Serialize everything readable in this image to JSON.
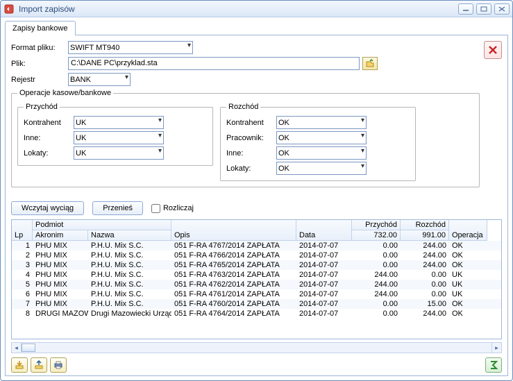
{
  "window": {
    "title": "Import zapisów"
  },
  "tab": {
    "label": "Zapisy bankowe"
  },
  "form": {
    "format_label": "Format pliku:",
    "format_value": "SWIFT MT940",
    "plik_label": "Plik:",
    "plik_value": "C:\\DANE PC\\przyklad.sta",
    "rejestr_label": "Rejestr",
    "rejestr_value": "BANK"
  },
  "ops": {
    "legend": "Operacje kasowe/bankowe",
    "income": {
      "legend": "Przychód",
      "kontrahent_label": "Kontrahent",
      "kontrahent_value": "UK",
      "inne_label": "Inne:",
      "inne_value": "UK",
      "lokaty_label": "Lokaty:",
      "lokaty_value": "UK"
    },
    "expense": {
      "legend": "Rozchód",
      "kontrahent_label": "Kontrahent",
      "kontrahent_value": "OK",
      "pracownik_label": "Pracownik:",
      "pracownik_value": "OK",
      "inne_label": "Inne:",
      "inne_value": "OK",
      "lokaty_label": "Lokaty:",
      "lokaty_value": "OK"
    }
  },
  "actions": {
    "wczytaj": "Wczytaj wyciąg",
    "przenies": "Przenieś",
    "rozliczaj": "Rozliczaj"
  },
  "grid": {
    "headers": {
      "lp": "Lp",
      "podmiot": "Podmiot",
      "akronim": "Akronim",
      "nazwa": "Nazwa",
      "opis": "Opis",
      "data": "Data",
      "przychod": "Przychód",
      "rozchod": "Rozchód",
      "operacja": "Operacja",
      "sum_przychod": "732.00",
      "sum_rozchod": "991.00"
    },
    "rows": [
      {
        "lp": "1",
        "akronim": "PHU MIX",
        "nazwa": "P.H.U. Mix S.C.",
        "opis": "051 F-RA 4767/2014 ZAPŁATA",
        "data": "2014-07-07",
        "przychod": "0.00",
        "rozchod": "244.00",
        "operacja": "OK"
      },
      {
        "lp": "2",
        "akronim": "PHU MIX",
        "nazwa": "P.H.U. Mix S.C.",
        "opis": "051 F-RA 4766/2014 ZAPŁATA",
        "data": "2014-07-07",
        "przychod": "0.00",
        "rozchod": "244.00",
        "operacja": "OK"
      },
      {
        "lp": "3",
        "akronim": "PHU MIX",
        "nazwa": "P.H.U. Mix S.C.",
        "opis": "051 F-RA 4765/2014 ZAPŁATA",
        "data": "2014-07-07",
        "przychod": "0.00",
        "rozchod": "244.00",
        "operacja": "OK"
      },
      {
        "lp": "4",
        "akronim": "PHU MIX",
        "nazwa": "P.H.U. Mix S.C.",
        "opis": "051 F-RA 4763/2014 ZAPŁATA",
        "data": "2014-07-07",
        "przychod": "244.00",
        "rozchod": "0.00",
        "operacja": "UK"
      },
      {
        "lp": "5",
        "akronim": "PHU MIX",
        "nazwa": "P.H.U. Mix S.C.",
        "opis": "051 F-RA 4762/2014 ZAPŁATA",
        "data": "2014-07-07",
        "przychod": "244.00",
        "rozchod": "0.00",
        "operacja": "UK"
      },
      {
        "lp": "6",
        "akronim": "PHU MIX",
        "nazwa": "P.H.U. Mix S.C.",
        "opis": "051 F-RA 4761/2014 ZAPŁATA",
        "data": "2014-07-07",
        "przychod": "244.00",
        "rozchod": "0.00",
        "operacja": "UK"
      },
      {
        "lp": "7",
        "akronim": "PHU MIX",
        "nazwa": "P.H.U. Mix S.C.",
        "opis": "051 F-RA 4760/2014 ZAPŁATA",
        "data": "2014-07-07",
        "przychod": "0.00",
        "rozchod": "15.00",
        "operacja": "OK"
      },
      {
        "lp": "8",
        "akronim": "DRUGI MAZOW",
        "nazwa": "Drugi Mazowiecki Urząd S",
        "opis": "051 F-RA 4764/2014 ZAPŁATA",
        "data": "2014-07-07",
        "przychod": "0.00",
        "rozchod": "244.00",
        "operacja": "OK"
      }
    ]
  }
}
